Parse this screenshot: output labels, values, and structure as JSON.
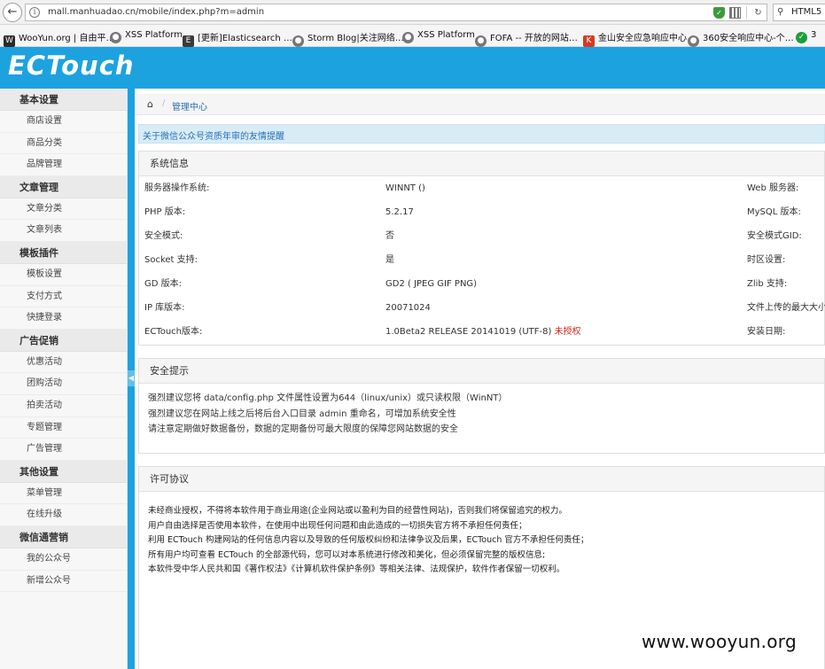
{
  "browser": {
    "url": "mall.manhuadao.cn/mobile/index.php?m=admin",
    "search_text": "HTML5 …",
    "bookmarks": [
      {
        "label": "WooYun.org | 自由平…",
        "icon": "wooyun-icon"
      },
      {
        "label": "XSS Platform",
        "icon": "globe-icon"
      },
      {
        "label": "[更新]Elasticsearch …",
        "icon": "elasticsearch-icon"
      },
      {
        "label": "Storm Blog|关注网络…",
        "icon": "globe-icon"
      },
      {
        "label": "XSS Platform",
        "icon": "globe-icon"
      },
      {
        "label": "FOFA -- 开放的网站…",
        "icon": "globe-icon"
      },
      {
        "label": "金山安全应急响应中心",
        "icon": "kingsoft-icon"
      },
      {
        "label": "360安全响应中心-个…",
        "icon": "globe-icon"
      },
      {
        "label": "3",
        "icon": "360-shield-icon"
      }
    ]
  },
  "header": {
    "logo": "ECTouch",
    "color": "#1da2e0"
  },
  "sidebar": {
    "groups": [
      {
        "title": "基本设置",
        "items": [
          "商店设置",
          "商品分类",
          "品牌管理"
        ]
      },
      {
        "title": "文章管理",
        "items": [
          "文章分类",
          "文章列表"
        ]
      },
      {
        "title": "模板插件",
        "items": [
          "模板设置",
          "支付方式",
          "快捷登录"
        ]
      },
      {
        "title": "广告促销",
        "items": [
          "优惠活动",
          "团购活动",
          "拍卖活动",
          "专题管理",
          "广告管理"
        ]
      },
      {
        "title": "其他设置",
        "items": [
          "菜单管理",
          "在线升级"
        ]
      },
      {
        "title": "微信通营销",
        "items": [
          "我的公众号",
          "新增公众号"
        ]
      }
    ]
  },
  "breadcrumb": {
    "current": "管理中心"
  },
  "notice": "关于微信公众号资质年审的友情提醒",
  "system_info": {
    "title": "系统信息",
    "rows": [
      {
        "label": "服务器操作系统:",
        "value": "WINNT ()",
        "label2": "Web 服务器:"
      },
      {
        "label": "PHP 版本:",
        "value": "5.2.17",
        "label2": "MySQL 版本:"
      },
      {
        "label": "安全模式:",
        "value": "否",
        "label2": "安全模式GID:"
      },
      {
        "label": "Socket 支持:",
        "value": "是",
        "label2": "时区设置:"
      },
      {
        "label": "GD 版本:",
        "value": "GD2 ( JPEG GIF PNG)",
        "label2": "Zlib 支持:"
      },
      {
        "label": "IP 库版本:",
        "value": "20071024",
        "label2": "文件上传的最大大小:"
      },
      {
        "label": "ECTouch版本:",
        "value": "1.0Beta2 RELEASE 20141019 (UTF-8)",
        "badge": "未授权",
        "label2": "安装日期:"
      }
    ]
  },
  "security_tips": {
    "title": "安全提示",
    "lines": [
      "强烈建议您将 data/config.php 文件属性设置为644（linux/unix）或只读权限（WinNT）",
      "强烈建议您在网站上线之后将后台入口目录 admin 重命名，可增加系统安全性",
      "请注意定期做好数据备份，数据的定期备份可最大限度的保障您网站数据的安全"
    ]
  },
  "license": {
    "title": "许可协议",
    "lines": [
      "未经商业授权，不得将本软件用于商业用途(企业网站或以盈利为目的经营性网站)，否则我们将保留追究的权力。",
      "用户自由选择是否使用本软件，在使用中出现任何问题和由此造成的一切损失官方将不承担任何责任；",
      "利用 ECTouch 构建网站的任何信息内容以及导致的任何版权纠纷和法律争议及后果，ECTouch 官方不承担任何责任；",
      "所有用户均可查看 ECTouch 的全部源代码，您可以对本系统进行修改和美化，但必须保留完整的版权信息;",
      "本软件受中华人民共和国《著作权法》《计算机软件保护条例》等相关法律、法规保护，软件作者保留一切权利。"
    ]
  },
  "watermark": "www.wooyun.org"
}
